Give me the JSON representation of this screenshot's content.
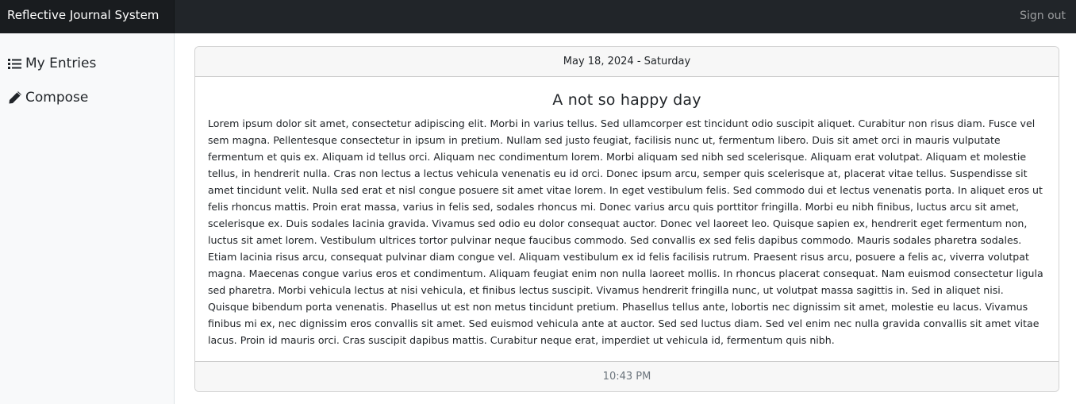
{
  "navbar": {
    "brand": "Reflective Journal System",
    "sign_out": "Sign out"
  },
  "sidebar": {
    "items": [
      {
        "label": "My Entries",
        "icon": "list-icon"
      },
      {
        "label": "Compose",
        "icon": "pencil-icon"
      }
    ]
  },
  "entry": {
    "date": "May 18, 2024 - Saturday",
    "title": "A not so happy day",
    "body": "Lorem ipsum dolor sit amet, consectetur adipiscing elit. Morbi in varius tellus. Sed ullamcorper est tincidunt odio suscipit aliquet. Curabitur non risus diam. Fusce vel sem magna. Pellentesque consectetur in ipsum in pretium. Nullam sed justo feugiat, facilisis nunc ut, fermentum libero. Duis sit amet orci in mauris vulputate fermentum et quis ex. Aliquam id tellus orci. Aliquam nec condimentum lorem. Morbi aliquam sed nibh sed scelerisque. Aliquam erat volutpat. Aliquam et molestie tellus, in hendrerit nulla. Cras non lectus a lectus vehicula venenatis eu id orci. Donec ipsum arcu, semper quis scelerisque at, placerat vitae tellus. Suspendisse sit amet tincidunt velit. Nulla sed erat et nisl congue posuere sit amet vitae lorem. In eget vestibulum felis. Sed commodo dui et lectus venenatis porta. In aliquet eros ut felis rhoncus mattis. Proin erat massa, varius in felis sed, sodales rhoncus mi. Donec varius arcu quis porttitor fringilla. Morbi eu nibh finibus, luctus arcu sit amet, scelerisque ex. Duis sodales lacinia gravida. Vivamus sed odio eu dolor consequat auctor. Donec vel laoreet leo. Quisque sapien ex, hendrerit eget fermentum non, luctus sit amet lorem. Vestibulum ultrices tortor pulvinar neque faucibus commodo. Sed convallis ex sed felis dapibus commodo. Mauris sodales pharetra sodales. Etiam lacinia risus arcu, consequat pulvinar diam congue vel. Aliquam vestibulum ex id felis facilisis rutrum. Praesent risus arcu, posuere a felis ac, viverra volutpat magna. Maecenas congue varius eros et condimentum. Aliquam feugiat enim non nulla laoreet mollis. In rhoncus placerat consequat. Nam euismod consectetur ligula sed pharetra. Morbi vehicula lectus at nisi vehicula, et finibus lectus suscipit. Vivamus hendrerit fringilla nunc, ut volutpat massa sagittis in. Sed in aliquet nisi. Quisque bibendum porta venenatis. Phasellus ut est non metus tincidunt pretium. Phasellus tellus ante, lobortis nec dignissim sit amet, molestie eu lacus. Vivamus finibus mi ex, nec dignissim eros convallis sit amet. Sed euismod vehicula ante at auctor. Sed sed luctus diam. Sed vel enim nec nulla gravida convallis sit amet vitae lacus. Proin id mauris orci. Cras suscipit dapibus mattis. Curabitur neque erat, imperdiet ut vehicula id, fermentum quis nibh.",
    "time": "10:43 PM"
  }
}
